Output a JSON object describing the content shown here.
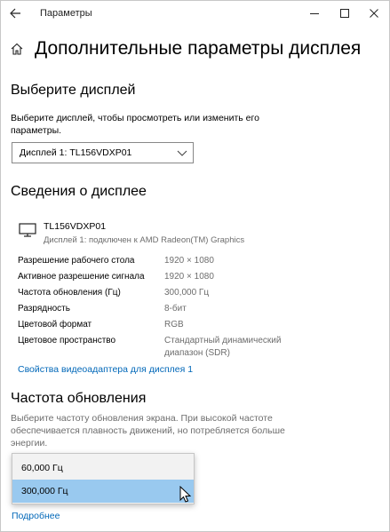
{
  "window": {
    "title": "Параметры"
  },
  "page": {
    "title": "Дополнительные параметры дисплея"
  },
  "select_display": {
    "heading": "Выберите дисплей",
    "description_line1": "Выберите дисплей, чтобы просмотреть или изменить его",
    "description_line2": "параметры.",
    "selected": "Дисплей 1: TL156VDXP01"
  },
  "display_info": {
    "heading": "Сведения о дисплее",
    "monitor_name": "TL156VDXP01",
    "monitor_sub": "Дисплей 1: подключен к AMD Radeon(TM) Graphics",
    "properties": [
      {
        "label": "Разрешение рабочего стола",
        "value": "1920 × 1080"
      },
      {
        "label": "Активное разрешение сигнала",
        "value": "1920 × 1080"
      },
      {
        "label": "Частота обновления (Гц)",
        "value": "300,000 Гц"
      },
      {
        "label": "Разрядность",
        "value": "8-бит"
      },
      {
        "label": "Цветовой формат",
        "value": "RGB"
      },
      {
        "label": "Цветовое пространство",
        "value_line1": "Стандартный динамический",
        "value_line2": "диапазон (SDR)"
      }
    ],
    "adapter_link": "Свойства видеоадаптера для дисплея 1"
  },
  "refresh_rate": {
    "heading": "Частота обновления",
    "description_line1": "Выберите частоту обновления экрана. При высокой частоте",
    "description_line2": "обеспечивается плавность движений, но потребляется больше",
    "description_line3": "энергии.",
    "options": [
      "60,000 Гц",
      "300,000 Гц"
    ],
    "highlighted_option": "300,000 Гц"
  },
  "more_link": "Подробнее",
  "colors": {
    "accent_link": "#0067b8",
    "highlight": "#99c9ef",
    "muted_text": "#6d6d6d"
  },
  "icons": [
    "back-arrow-icon",
    "minimize-icon",
    "maximize-icon",
    "close-icon",
    "home-icon",
    "chevron-down-icon",
    "monitor-icon",
    "mouse-cursor-icon"
  ]
}
